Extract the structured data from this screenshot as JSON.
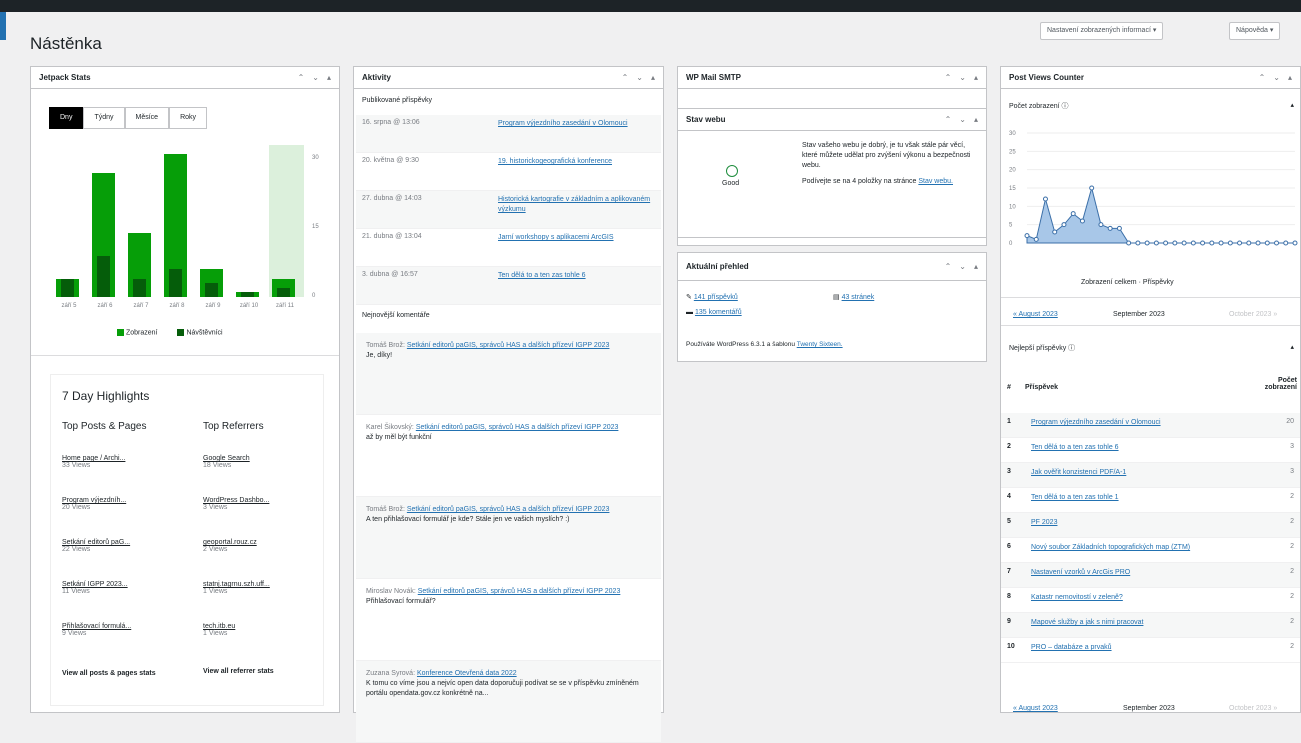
{
  "page": {
    "title": "Nástěnka",
    "screen_options": "Nastavení zobrazených informací ▾",
    "help": "Nápověda ▾"
  },
  "jetpack": {
    "title": "Jetpack Stats",
    "tabs": [
      "Dny",
      "Týdny",
      "Měsíce",
      "Roky"
    ],
    "chart_data": {
      "type": "bar",
      "categories": [
        "září 5",
        "září 6",
        "září 7",
        "září 8",
        "září 9",
        "září 10",
        "září 11"
      ],
      "series": [
        {
          "name": "Zobrazení",
          "values": [
            4,
            27,
            14,
            31,
            6,
            1,
            4
          ]
        },
        {
          "name": "Návštěvníci",
          "values": [
            4,
            9,
            4,
            6,
            3,
            1,
            2
          ]
        }
      ],
      "yticks": [
        "0",
        "15",
        "30"
      ],
      "ylim": [
        0,
        33
      ]
    },
    "legend": [
      "Zobrazení",
      "Návštěvníci"
    ]
  },
  "highlights": {
    "title": "7 Day Highlights",
    "posts_head": "Top Posts & Pages",
    "ref_head": "Top Referrers",
    "posts": [
      {
        "name": "Home page / Archi...",
        "views": "33 Views"
      },
      {
        "name": "Program výjezdníh...",
        "views": "20 Views"
      },
      {
        "name": "Setkání editorů paG...",
        "views": "22 Views"
      },
      {
        "name": "Setkání IGPP 2023...",
        "views": "11 Views"
      },
      {
        "name": "Přihlašovací formulá...",
        "views": "9 Views"
      }
    ],
    "refs": [
      {
        "name": "Google Search",
        "views": "18 Views"
      },
      {
        "name": "WordPress Dashbo...",
        "views": "3 Views"
      },
      {
        "name": "geoportal.rouz.cz",
        "views": "2 Views"
      },
      {
        "name": "statnj.tagrnu.szh.uff...",
        "views": "1 Views"
      },
      {
        "name": "tech.itb.eu",
        "views": "1 Views"
      }
    ],
    "all_posts": "View all posts & pages stats",
    "all_refs": "View all referrer stats"
  },
  "activity": {
    "title": "Aktivity",
    "published_head": "Publikované příspěvky",
    "published": [
      {
        "date": "16. srpna @ 13:06",
        "title": "Program výjezdního zasedání v Olomouci"
      },
      {
        "date": "20. května @ 9:30",
        "title": "19. historickogeografická konference"
      },
      {
        "date": "27. dubna @ 14:03",
        "title": "Historická kartografie v základním a aplikovaném výzkumu"
      },
      {
        "date": "21. dubna @ 13:04",
        "title": "Jarní workshopy s aplikacemi ArcGIS"
      },
      {
        "date": "3. dubna @ 16:57",
        "title": "Ten dělá to a ten zas tohle 6"
      }
    ],
    "comments_head": "Nejnovější komentáře",
    "comments": [
      {
        "author": "Tomáš Brož:",
        "link": "Setkání editorů paGIS, správců HAS a dalších přízeví IGPP 2023",
        "text": "Je, díky!"
      },
      {
        "author": "Karel Šikovský:",
        "link": "Setkání editorů paGIS, správců HAS a dalších přízeví IGPP 2023",
        "text": "až by měl být funkční"
      },
      {
        "author": "Tomáš Brož:",
        "link": "Setkání editorů paGIS, správců HAS a dalších přízeví IGPP 2023",
        "text": "A ten přihlašovací formulář je kde? Stále jen ve vašich myslích? :)"
      },
      {
        "author": "Miroslav Novák:",
        "link": "Setkání editorů paGIS, správců HAS a dalších přízeví IGPP 2023",
        "text": "Přihlašovací formulář?"
      },
      {
        "author": "Zuzana Syrová:",
        "link": "Konference Otevřená data 2022",
        "text": "K tomu co víme jsou a nejvíc open data doporučuji podívat se se v příspěvku zmíněném portálu opendata.gov.cz konkrétně na..."
      }
    ]
  },
  "smtp": {
    "title": "WP Mail SMTP"
  },
  "health": {
    "title": "Stav webu",
    "status": "Good",
    "desc": "Stav vašeho webu je dobrý, je tu však stále pár věcí, které můžete udělat pro zvýšení výkonu a bezpečnosti webu.",
    "hint": "Podívejte se na 4 položky na stránce",
    "link": "Stav webu."
  },
  "glance": {
    "title": "Aktuální přehled",
    "posts": "141 příspěvků",
    "pages": "43 stránek",
    "comments": "135 komentářů",
    "footer": "Používáte WordPress 6.3.1 a šablonu",
    "theme": "Twenty Sixteen."
  },
  "pvc": {
    "title": "Post Views Counter",
    "views_head": "Počet zobrazení ⓘ",
    "chart_data": {
      "type": "area",
      "x": [
        1,
        2,
        3,
        4,
        5,
        6,
        7,
        8,
        9,
        10,
        11,
        12,
        13,
        14,
        15,
        16,
        17,
        18,
        19,
        20,
        21,
        22,
        23,
        24,
        25,
        26,
        27,
        28,
        29,
        30
      ],
      "y": [
        2,
        1,
        12,
        3,
        5,
        8,
        6,
        15,
        5,
        4,
        4,
        0,
        0,
        0,
        0,
        0,
        0,
        0,
        0,
        0,
        0,
        0,
        0,
        0,
        0,
        0,
        0,
        0,
        0,
        0
      ],
      "yticks": [
        "0",
        "5",
        "10",
        "15",
        "20",
        "25",
        "30"
      ],
      "ylim": [
        0,
        30
      ]
    },
    "legend": "Zobrazení celkem · Příspěvky",
    "prev": "« August 2023",
    "current": "September 2023",
    "next": "October 2023 »",
    "top_head": "Nejlepší příspěvky ⓘ",
    "col_n": "#",
    "col_post": "Příspěvek",
    "col_views": "Počet zobrazení",
    "top": [
      {
        "n": "1",
        "t": "Program výjezdního zasedání v Olomouci",
        "v": "20"
      },
      {
        "n": "2",
        "t": "Ten dělá to a ten zas tohle 6",
        "v": "3"
      },
      {
        "n": "3",
        "t": "Jak ověřit konzistenci PDF/A-1",
        "v": "3"
      },
      {
        "n": "4",
        "t": "Ten dělá to a ten zas tohle 1",
        "v": "2"
      },
      {
        "n": "5",
        "t": "PF 2023",
        "v": "2"
      },
      {
        "n": "6",
        "t": "Nový soubor Základních topografických map (ZTM)",
        "v": "2"
      },
      {
        "n": "7",
        "t": "Nastavení vzorků v ArcGis PRO",
        "v": "2"
      },
      {
        "n": "8",
        "t": "Katastr nemovitostí v zeleně?",
        "v": "2"
      },
      {
        "n": "9",
        "t": "Mapové služby a jak s nimi pracovat",
        "v": "2"
      },
      {
        "n": "10",
        "t": "PRO – databáze a prvaků",
        "v": "2"
      }
    ],
    "prev2": "« August 2023",
    "current2": "September 2023",
    "next2": "October 2023 »"
  }
}
